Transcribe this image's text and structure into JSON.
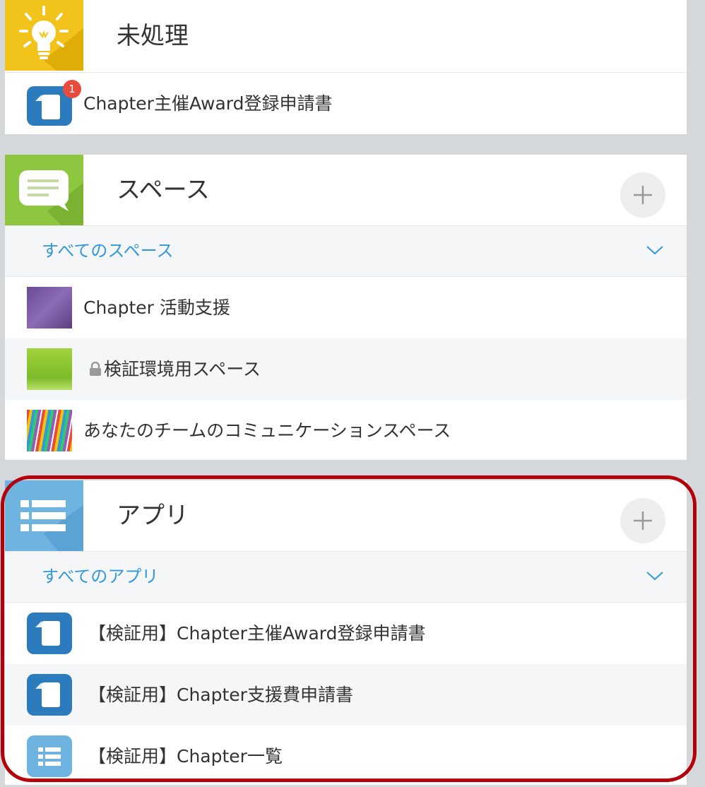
{
  "unprocessed": {
    "title": "未処理",
    "items": [
      {
        "label": "Chapter主催Award登録申請書",
        "badge": "1"
      }
    ]
  },
  "spaces": {
    "title": "スペース",
    "filter": "すべてのスペース",
    "items": [
      {
        "label": "Chapter 活動支援"
      },
      {
        "label": "検証環境用スペース"
      },
      {
        "label": "あなたのチームのコミュニケーションスペース"
      }
    ]
  },
  "apps": {
    "title": "アプリ",
    "filter": "すべてのアプリ",
    "items": [
      {
        "label": "【検証用】Chapter主催Award登録申請書"
      },
      {
        "label": "【検証用】Chapter支援費申請書"
      },
      {
        "label": "【検証用】Chapter一覧"
      }
    ]
  },
  "colors": {
    "unprocessed_header": "#f2c31a",
    "spaces_header": "#8dc63f",
    "apps_header": "#6fb3e0",
    "link": "#3498db",
    "highlight": "#b4000a"
  }
}
